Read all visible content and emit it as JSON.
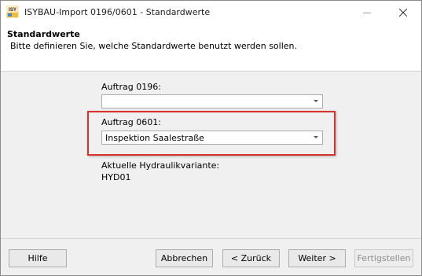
{
  "window": {
    "title": "ISYBAU-Import 0196/0601 - Standardwerte",
    "icon_text": "ISY"
  },
  "header": {
    "title": "Standardwerte",
    "subtitle": "Bitte definieren Sie, welche Standardwerte benutzt werden sollen."
  },
  "form": {
    "auftrag0196_label": "Auftrag 0196:",
    "auftrag0196_value": "",
    "auftrag0601_label": "Auftrag 0601:",
    "auftrag0601_value": "Inspektion Saalestraße",
    "hydraulik_label": "Aktuelle Hydraulikvariante:",
    "hydraulik_value": "HYD01"
  },
  "buttons": {
    "help": "Hilfe",
    "cancel": "Abbrechen",
    "back": "< Zurück",
    "next": "Weiter >",
    "finish": "Fertigstellen"
  },
  "colors": {
    "highlight": "#d9312b"
  }
}
